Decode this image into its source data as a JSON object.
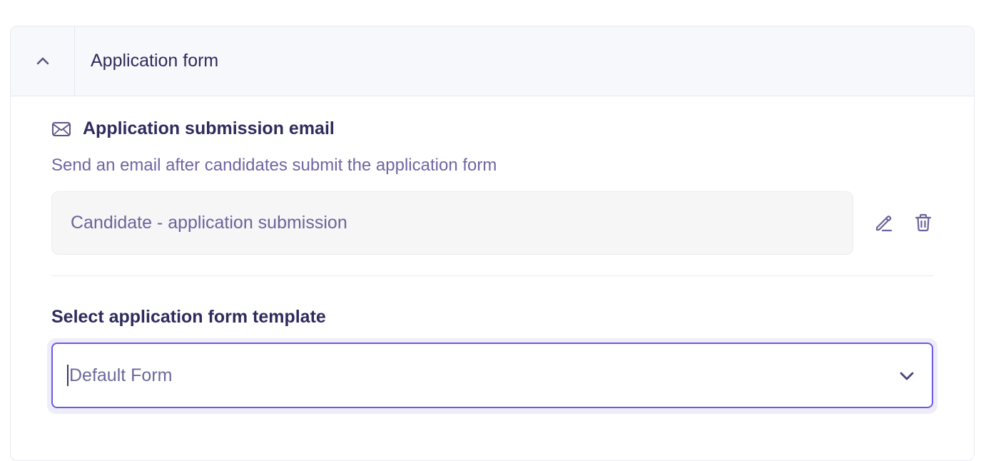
{
  "panel": {
    "title": "Application form",
    "collapse_icon": "chevron-up-icon"
  },
  "email_section": {
    "icon": "mail-icon",
    "title": "Application submission email",
    "description": "Send an email after candidates submit the application form",
    "email_template": "Candidate - application submission",
    "edit_icon": "pencil-icon",
    "delete_icon": "trash-icon"
  },
  "form_template": {
    "label": "Select application form template",
    "selected_value": "Default Form",
    "dropdown_icon": "chevron-down-icon"
  },
  "colors": {
    "accent": "#6a5be2",
    "text_primary": "#2f2b5c",
    "text_secondary": "#6e66a3",
    "header_bg": "#f7f8fc"
  }
}
